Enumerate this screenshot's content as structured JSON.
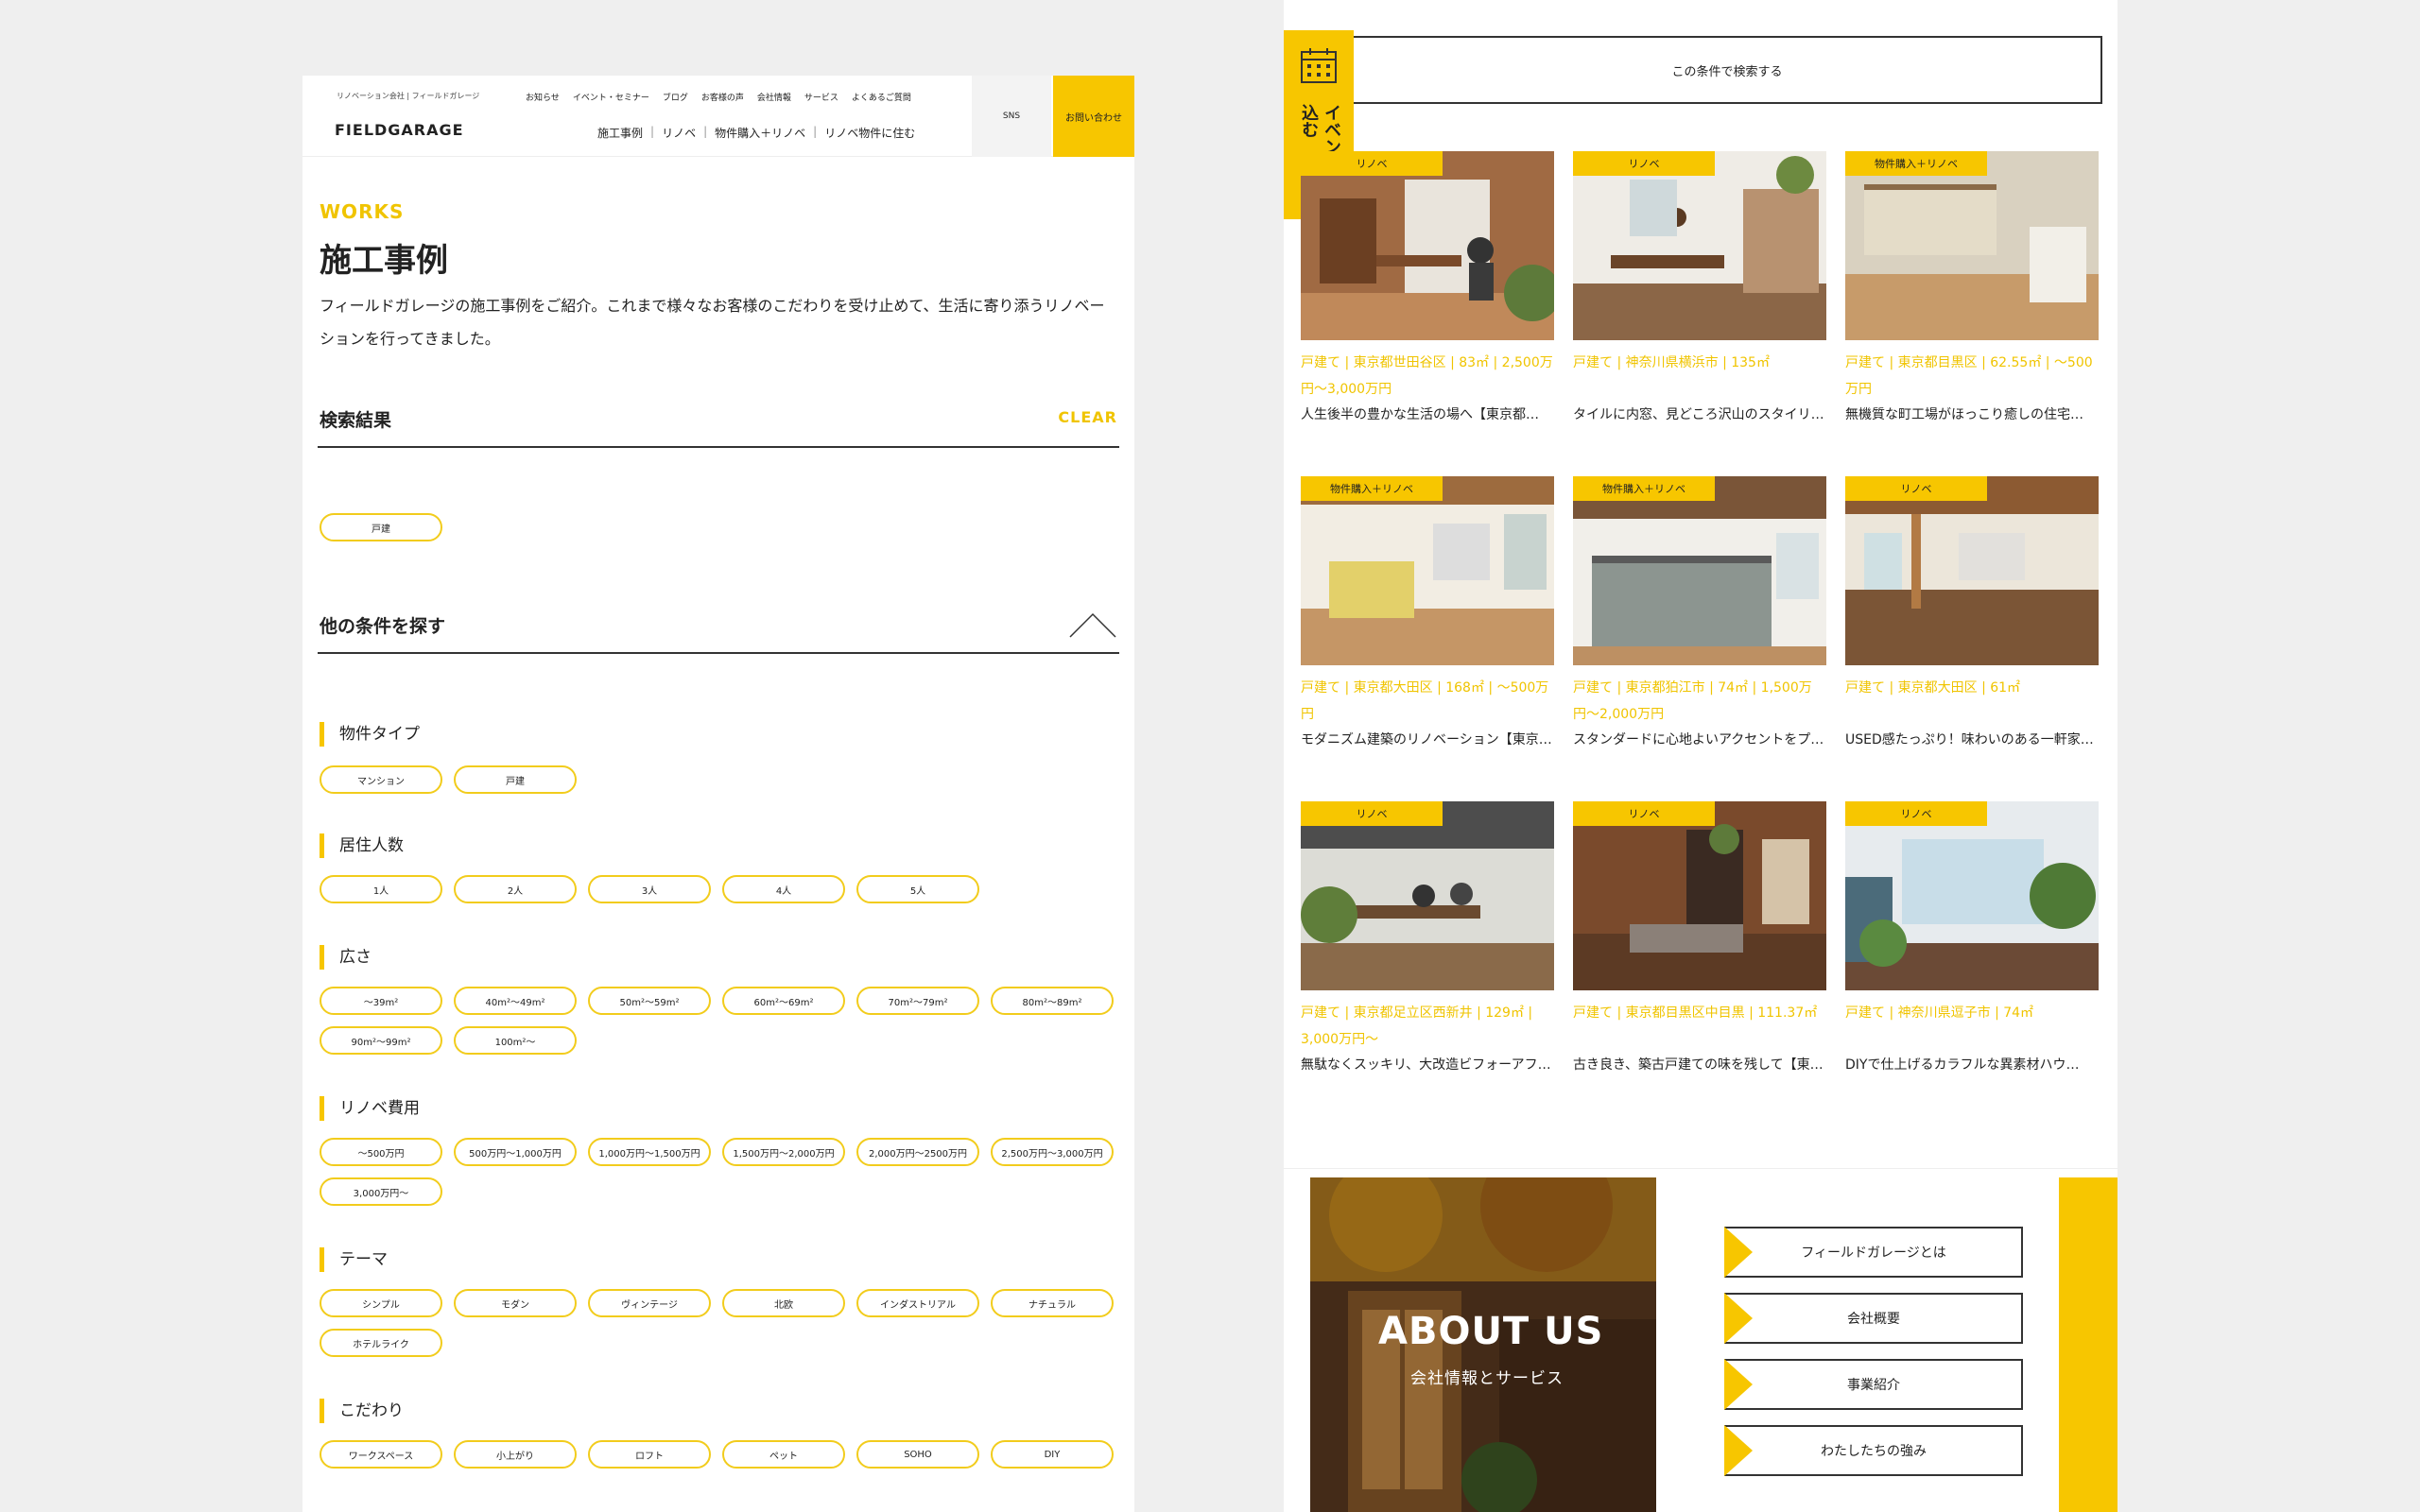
{
  "header": {
    "tagline": "リノベーション会社 | フィールドガレージ",
    "logo": "FIELDGARAGE",
    "nav_top": [
      "お知らせ",
      "イベント・セミナー",
      "ブログ",
      "お客様の声",
      "会社情報",
      "サービス",
      "よくあるご質問"
    ],
    "nav_main": [
      "施工事例",
      "リノベ",
      "物件購入＋リノベ",
      "リノベ物件に住む"
    ],
    "sns": "SNS",
    "contact": "お問い合わせ"
  },
  "page": {
    "eyebrow": "WORKS",
    "title": "施工事例",
    "description": "フィールドガレージの施工事例をご紹介。これまで様々なお客様のこだわりを受け止めて、生活に寄り添うリノベーションを行ってきました。"
  },
  "results": {
    "title": "検索結果",
    "clear": "CLEAR",
    "selected": [
      "戸建"
    ]
  },
  "filters": {
    "title": "他の条件を探す",
    "groups": [
      {
        "label": "物件タイプ",
        "options": [
          "マンション",
          "戸建"
        ]
      },
      {
        "label": "居住人数",
        "options": [
          "1人",
          "2人",
          "3人",
          "4人",
          "5人"
        ]
      },
      {
        "label": "広さ",
        "options": [
          "〜39m²",
          "40m²〜49m²",
          "50m²〜59m²",
          "60m²〜69m²",
          "70m²〜79m²",
          "80m²〜89m²",
          "90m²〜99m²",
          "100m²〜"
        ]
      },
      {
        "label": "リノベ費用",
        "options": [
          "〜500万円",
          "500万円〜1,000万円",
          "1,000万円〜1,500万円",
          "1,500万円〜2,000万円",
          "2,000万円〜2500万円",
          "2,500万円〜3,000万円",
          "3,000万円〜"
        ]
      },
      {
        "label": "テーマ",
        "options": [
          "シンプル",
          "モダン",
          "ヴィンテージ",
          "北欧",
          "インダストリアル",
          "ナチュラル",
          "ホテルライク"
        ]
      },
      {
        "label": "こだわり",
        "options": [
          "ワークスペース",
          "小上がり",
          "ロフト",
          "ペット",
          "SOHO",
          "DIY"
        ]
      }
    ]
  },
  "search_button": "この条件で検索する",
  "event_tab": "イベントに申し込む",
  "cards": [
    {
      "badge": "リノベ",
      "meta": "戸建て | 東京都世田谷区 | 83㎡ | 2,500万円〜3,000万円",
      "caption": "人生後半の豊かな生活の場へ【東京都…"
    },
    {
      "badge": "リノベ",
      "meta": "戸建て | 神奈川県横浜市 | 135㎡",
      "caption": "タイルに内窓、見どころ沢山のスタイリ…"
    },
    {
      "badge": "物件購入＋リノベ",
      "meta": "戸建て | 東京都目黒区 | 62.55㎡ | 〜500万円",
      "caption": "無機質な町工場がほっこり癒しの住宅…"
    },
    {
      "badge": "物件購入＋リノベ",
      "meta": "戸建て | 東京都大田区 | 168㎡ | 〜500万円",
      "caption": "モダニズム建築のリノベーション【東京…"
    },
    {
      "badge": "物件購入＋リノベ",
      "meta": "戸建て | 東京都狛江市 | 74㎡ | 1,500万円〜2,000万円",
      "caption": "スタンダードに心地よいアクセントをプ…"
    },
    {
      "badge": "リノベ",
      "meta": "戸建て | 東京都大田区 | 61㎡",
      "caption": "USED感たっぷり！味わいのある一軒家…"
    },
    {
      "badge": "リノベ",
      "meta": "戸建て | 東京都足立区西新井 | 129㎡ | 3,000万円〜",
      "caption": "無駄なくスッキリ、大改造ビフォーアフ…"
    },
    {
      "badge": "リノベ",
      "meta": "戸建て | 東京都目黒区中目黒 | 111.37㎡",
      "caption": "古き良き、築古戸建ての味を残して【東…"
    },
    {
      "badge": "リノベ",
      "meta": "戸建て | 神奈川県逗子市 | 74㎡",
      "caption": "DIYで仕上げるカラフルな異素材ハウ…"
    }
  ],
  "about": {
    "title": "ABOUT US",
    "subtitle": "会社情報とサービス",
    "links": [
      "フィールドガレージとは",
      "会社概要",
      "事業紹介",
      "わたしたちの強み"
    ]
  }
}
